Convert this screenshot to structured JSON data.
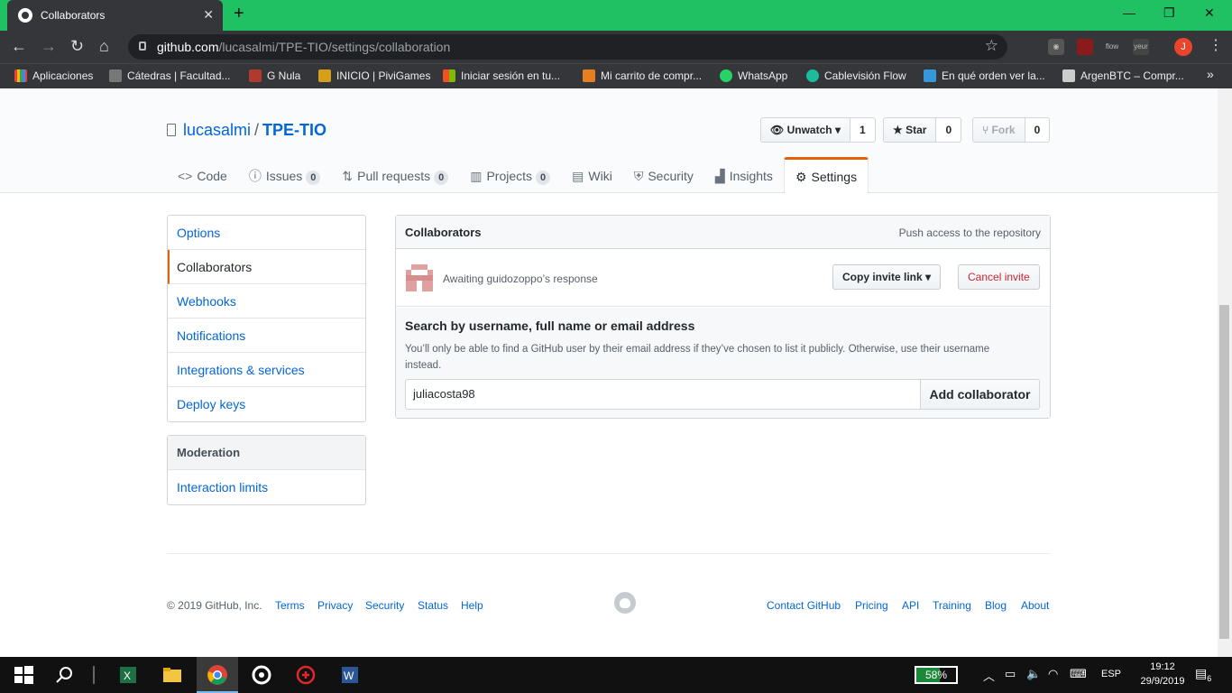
{
  "browser": {
    "tab_title": "Collaborators",
    "url_host": "github.com",
    "url_path": "/lucasalmi/TPE-TIO/settings/collaboration",
    "profile_initial": "J",
    "bookmarks": [
      {
        "label": "Aplicaciones",
        "color": "#e34c26"
      },
      {
        "label": "Cátedras | Facultad...",
        "color": "#888888"
      },
      {
        "label": "G Nula",
        "color": "#b03a2e"
      },
      {
        "label": "INICIO | PiviGames",
        "color": "#d4a017"
      },
      {
        "label": "Iniciar sesión en tu...",
        "color": "#f25022"
      },
      {
        "label": "Mi carrito de compr...",
        "color": "#e67e22"
      },
      {
        "label": "WhatsApp",
        "color": "#25d366"
      },
      {
        "label": "Cablevisión Flow",
        "color": "#1abc9c"
      },
      {
        "label": "En qué orden ver la...",
        "color": "#3498db"
      },
      {
        "label": "ArgenBTC – Compr...",
        "color": "#cccccc"
      }
    ],
    "more_bookmarks": "»",
    "ext_labels": [
      "flow",
      "yeur"
    ]
  },
  "repo": {
    "owner": "lucasalmi",
    "separator": "/",
    "name": "TPE-TIO",
    "watch_label": "Unwatch",
    "watch_count": "1",
    "star_label": "Star",
    "star_count": "0",
    "fork_label": "Fork",
    "fork_count": "0",
    "tabs": [
      {
        "label": "Code",
        "count": null
      },
      {
        "label": "Issues",
        "count": "0"
      },
      {
        "label": "Pull requests",
        "count": "0"
      },
      {
        "label": "Projects",
        "count": "0"
      },
      {
        "label": "Wiki",
        "count": null
      },
      {
        "label": "Security",
        "count": null
      },
      {
        "label": "Insights",
        "count": null
      },
      {
        "label": "Settings",
        "count": null
      }
    ]
  },
  "sidebar": {
    "items": [
      "Options",
      "Collaborators",
      "Webhooks",
      "Notifications",
      "Integrations & services",
      "Deploy keys"
    ],
    "moderation_heading": "Moderation",
    "moderation_items": [
      "Interaction limits"
    ]
  },
  "collaborators": {
    "title": "Collaborators",
    "subtitle": "Push access to the repository",
    "pending_text": "Awaiting guidozoppo’s response",
    "copy_invite": "Copy invite link",
    "cancel_invite": "Cancel invite",
    "search_heading": "Search by username, full name or email address",
    "search_note": "You’ll only be able to find a GitHub user by their email address if they’ve chosen to list it publicly. Otherwise, use their username instead.",
    "search_value": "juliacosta98",
    "add_button": "Add collaborator"
  },
  "footer": {
    "copyright": "© 2019 GitHub, Inc.",
    "left_links": [
      "Terms",
      "Privacy",
      "Security",
      "Status",
      "Help"
    ],
    "right_links": [
      "Contact GitHub",
      "Pricing",
      "API",
      "Training",
      "Blog",
      "About"
    ]
  },
  "taskbar": {
    "battery_percent": 58,
    "battery_label": "58%",
    "language": "ESP",
    "time": "19:12",
    "date": "29/9/2019",
    "notifications": "6"
  },
  "colors": {
    "tabbar": "#1fc163",
    "link": "#0366d6",
    "accent": "#e36209",
    "danger": "#cb2431"
  }
}
